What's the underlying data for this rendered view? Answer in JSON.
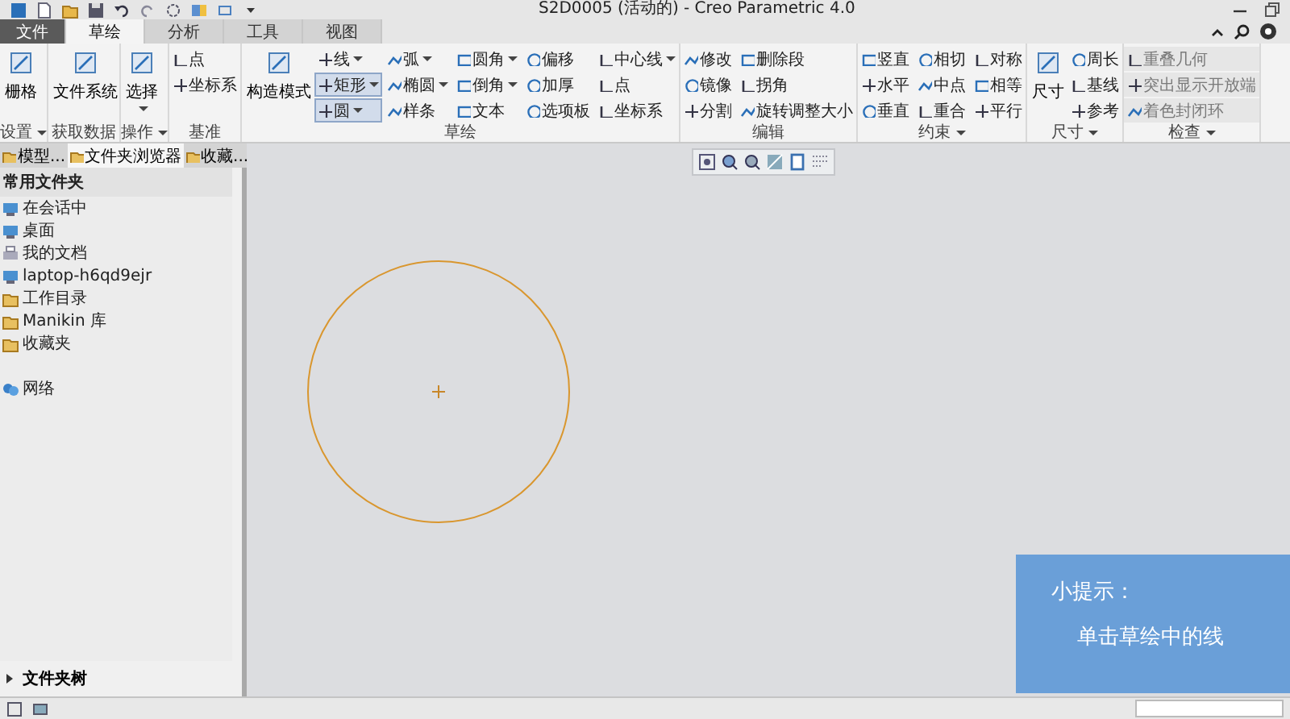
{
  "window": {
    "title": "S2D0005 (活动的) - Creo Parametric 4.0"
  },
  "menu_tabs": [
    {
      "label": "文件",
      "selected": false,
      "kind": "file"
    },
    {
      "label": "草绘",
      "selected": true,
      "kind": "tab"
    },
    {
      "label": "分析",
      "selected": false,
      "kind": "tab"
    },
    {
      "label": "工具",
      "selected": false,
      "kind": "tab"
    },
    {
      "label": "视图",
      "selected": false,
      "kind": "tab"
    }
  ],
  "ribbon_groups": [
    {
      "label": "设置",
      "dropdown": true,
      "large": [
        {
          "label": "栅格",
          "dropdown": false
        }
      ]
    },
    {
      "label": "获取数据",
      "dropdown": false,
      "large": [
        {
          "label": "文件系统",
          "dropdown": false
        }
      ]
    },
    {
      "label": "操作",
      "dropdown": true,
      "large": [
        {
          "label": "选择",
          "dropdown": true
        }
      ]
    },
    {
      "label": "基准",
      "dropdown": false,
      "grid": [
        {
          "label": "点",
          "dropdown": false,
          "selected": false,
          "disabled": false
        },
        {
          "label": "坐标系",
          "dropdown": false,
          "selected": false,
          "disabled": false
        }
      ]
    },
    {
      "label": "草绘",
      "dropdown": false,
      "large": [
        {
          "label": "构造模式",
          "dropdown": false
        }
      ],
      "grid": [
        {
          "label": "线",
          "dropdown": true,
          "selected": false,
          "disabled": false
        },
        {
          "label": "弧",
          "dropdown": true,
          "selected": false,
          "disabled": false
        },
        {
          "label": "圆角",
          "dropdown": true,
          "selected": false,
          "disabled": false
        },
        {
          "label": "偏移",
          "dropdown": false,
          "selected": false,
          "disabled": false
        },
        {
          "label": "中心线",
          "dropdown": true,
          "selected": false,
          "disabled": false
        },
        {
          "label": "矩形",
          "dropdown": true,
          "selected": true,
          "disabled": false
        },
        {
          "label": "椭圆",
          "dropdown": true,
          "selected": false,
          "disabled": false
        },
        {
          "label": "倒角",
          "dropdown": true,
          "selected": false,
          "disabled": false
        },
        {
          "label": "加厚",
          "dropdown": false,
          "selected": false,
          "disabled": false
        },
        {
          "label": "点",
          "dropdown": false,
          "selected": false,
          "disabled": false
        },
        {
          "label": "圆",
          "dropdown": true,
          "selected": true,
          "disabled": false
        },
        {
          "label": "样条",
          "dropdown": false,
          "selected": false,
          "disabled": false
        },
        {
          "label": "文本",
          "dropdown": false,
          "selected": false,
          "disabled": false
        },
        {
          "label": "选项板",
          "dropdown": false,
          "selected": false,
          "disabled": false
        },
        {
          "label": "坐标系",
          "dropdown": false,
          "selected": false,
          "disabled": false
        }
      ]
    },
    {
      "label": "编辑",
      "dropdown": false,
      "grid": [
        {
          "label": "修改",
          "dropdown": false,
          "selected": false,
          "disabled": false
        },
        {
          "label": "删除段",
          "dropdown": false,
          "selected": false,
          "disabled": false
        },
        {
          "label": "镜像",
          "dropdown": false,
          "selected": false,
          "disabled": false
        },
        {
          "label": "拐角",
          "dropdown": false,
          "selected": false,
          "disabled": false
        },
        {
          "label": "分割",
          "dropdown": false,
          "selected": false,
          "disabled": false
        },
        {
          "label": "旋转调整大小",
          "dropdown": false,
          "selected": false,
          "disabled": false
        }
      ]
    },
    {
      "label": "约束",
      "dropdown": true,
      "grid": [
        {
          "label": "竖直",
          "dropdown": false,
          "selected": false,
          "disabled": false
        },
        {
          "label": "相切",
          "dropdown": false,
          "selected": false,
          "disabled": false
        },
        {
          "label": "对称",
          "dropdown": false,
          "selected": false,
          "disabled": false
        },
        {
          "label": "水平",
          "dropdown": false,
          "selected": false,
          "disabled": false
        },
        {
          "label": "中点",
          "dropdown": false,
          "selected": false,
          "disabled": false
        },
        {
          "label": "相等",
          "dropdown": false,
          "selected": false,
          "disabled": false
        },
        {
          "label": "垂直",
          "dropdown": false,
          "selected": false,
          "disabled": false
        },
        {
          "label": "重合",
          "dropdown": false,
          "selected": false,
          "disabled": false
        },
        {
          "label": "平行",
          "dropdown": false,
          "selected": false,
          "disabled": false
        }
      ]
    },
    {
      "label": "尺寸",
      "dropdown": true,
      "large": [
        {
          "label": "尺寸",
          "dropdown": false
        }
      ],
      "grid": [
        {
          "label": "周长",
          "dropdown": false,
          "selected": false,
          "disabled": false
        },
        {
          "label": "基线",
          "dropdown": false,
          "selected": false,
          "disabled": false
        },
        {
          "label": "参考",
          "dropdown": false,
          "selected": false,
          "disabled": false
        }
      ]
    },
    {
      "label": "检查",
      "dropdown": true,
      "grid": [
        {
          "label": "重叠几何",
          "dropdown": false,
          "selected": false,
          "disabled": true
        },
        {
          "label": "突出显示开放端",
          "dropdown": false,
          "selected": false,
          "disabled": true
        },
        {
          "label": "着色封闭环",
          "dropdown": false,
          "selected": false,
          "disabled": true
        }
      ]
    }
  ],
  "sidebar": {
    "tabs": [
      {
        "label": "模型...",
        "selected": false
      },
      {
        "label": "文件夹浏览器",
        "selected": true
      },
      {
        "label": "收藏...",
        "selected": false
      }
    ],
    "header": "常用文件夹",
    "items": [
      {
        "label": "在会话中",
        "kind": "computer"
      },
      {
        "label": "桌面",
        "kind": "computer"
      },
      {
        "label": "我的文档",
        "kind": "printer"
      },
      {
        "label": "laptop-h6qd9ejr",
        "kind": "computer"
      },
      {
        "label": "工作目录",
        "kind": "folder"
      },
      {
        "label": "Manikin 库",
        "kind": "folder"
      },
      {
        "label": "收藏夹",
        "kind": "folder"
      },
      {
        "label": "网络",
        "kind": "network"
      }
    ],
    "footer": {
      "label": "文件夹树",
      "expanded": false
    }
  },
  "tip": {
    "title": "小提示：",
    "text": "单击草绘中的线"
  }
}
